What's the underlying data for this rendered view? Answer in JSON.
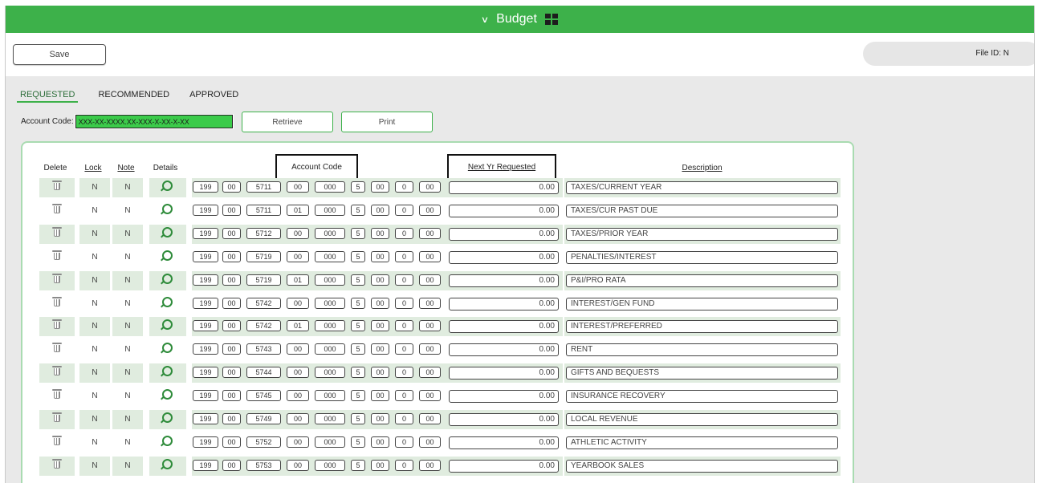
{
  "header": {
    "title": "Budget",
    "menu_icon": "chevron-down-icon",
    "grid_icon": "grid-layout-icon"
  },
  "toolbar": {
    "save_label": "Save",
    "file_id": "File ID: N"
  },
  "tabs": [
    "REQUESTED",
    "RECOMMENDED",
    "APPROVED"
  ],
  "search": {
    "label": "Account Code:",
    "value": "XXX-XX-XXXX.XX-XXX-X-XX-X-XX"
  },
  "buttons": {
    "retrieve": "Retrieve",
    "print": "Print"
  },
  "columns": {
    "delete": "Delete",
    "lock": "Lock",
    "note": "Note",
    "details": "Details",
    "account_code": "Account Code",
    "next_yr": "Next Yr Requested",
    "description": "Description"
  },
  "colors": {
    "accent": "#3db14a",
    "row_shade": "#e0ecdf",
    "input_highlight": "#3bcb4a"
  },
  "rows": [
    {
      "lock": "N",
      "note": "N",
      "code": [
        "199",
        "00",
        "5711",
        "00",
        "000",
        "5",
        "00",
        "0",
        "00"
      ],
      "amount": "0.00",
      "description": "TAXES/CURRENT YEAR"
    },
    {
      "lock": "N",
      "note": "N",
      "code": [
        "199",
        "00",
        "5711",
        "01",
        "000",
        "5",
        "00",
        "0",
        "00"
      ],
      "amount": "0.00",
      "description": "TAXES/CUR PAST DUE"
    },
    {
      "lock": "N",
      "note": "N",
      "code": [
        "199",
        "00",
        "5712",
        "00",
        "000",
        "5",
        "00",
        "0",
        "00"
      ],
      "amount": "0.00",
      "description": "TAXES/PRIOR YEAR"
    },
    {
      "lock": "N",
      "note": "N",
      "code": [
        "199",
        "00",
        "5719",
        "00",
        "000",
        "5",
        "00",
        "0",
        "00"
      ],
      "amount": "0.00",
      "description": "PENALTIES/INTEREST"
    },
    {
      "lock": "N",
      "note": "N",
      "code": [
        "199",
        "00",
        "5719",
        "01",
        "000",
        "5",
        "00",
        "0",
        "00"
      ],
      "amount": "0.00",
      "description": "P&I/PRO RATA"
    },
    {
      "lock": "N",
      "note": "N",
      "code": [
        "199",
        "00",
        "5742",
        "00",
        "000",
        "5",
        "00",
        "0",
        "00"
      ],
      "amount": "0.00",
      "description": "INTEREST/GEN FUND"
    },
    {
      "lock": "N",
      "note": "N",
      "code": [
        "199",
        "00",
        "5742",
        "01",
        "000",
        "5",
        "00",
        "0",
        "00"
      ],
      "amount": "0.00",
      "description": "INTEREST/PREFERRED"
    },
    {
      "lock": "N",
      "note": "N",
      "code": [
        "199",
        "00",
        "5743",
        "00",
        "000",
        "5",
        "00",
        "0",
        "00"
      ],
      "amount": "0.00",
      "description": "RENT"
    },
    {
      "lock": "N",
      "note": "N",
      "code": [
        "199",
        "00",
        "5744",
        "00",
        "000",
        "5",
        "00",
        "0",
        "00"
      ],
      "amount": "0.00",
      "description": "GIFTS AND BEQUESTS"
    },
    {
      "lock": "N",
      "note": "N",
      "code": [
        "199",
        "00",
        "5745",
        "00",
        "000",
        "5",
        "00",
        "0",
        "00"
      ],
      "amount": "0.00",
      "description": "INSURANCE RECOVERY"
    },
    {
      "lock": "N",
      "note": "N",
      "code": [
        "199",
        "00",
        "5749",
        "00",
        "000",
        "5",
        "00",
        "0",
        "00"
      ],
      "amount": "0.00",
      "description": "LOCAL REVENUE"
    },
    {
      "lock": "N",
      "note": "N",
      "code": [
        "199",
        "00",
        "5752",
        "00",
        "000",
        "5",
        "00",
        "0",
        "00"
      ],
      "amount": "0.00",
      "description": "ATHLETIC ACTIVITY"
    },
    {
      "lock": "N",
      "note": "N",
      "code": [
        "199",
        "00",
        "5753",
        "00",
        "000",
        "5",
        "00",
        "0",
        "00"
      ],
      "amount": "0.00",
      "description": "YEARBOOK SALES"
    }
  ]
}
